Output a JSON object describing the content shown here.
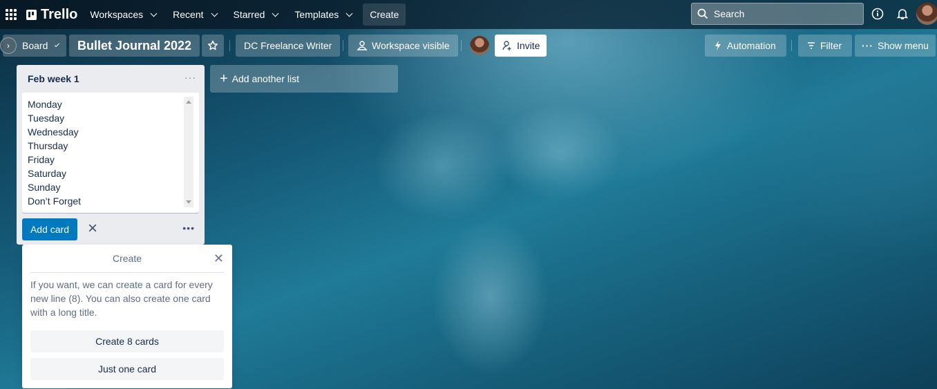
{
  "topbar": {
    "app_name": "Trello",
    "nav": [
      {
        "label": "Workspaces"
      },
      {
        "label": "Recent"
      },
      {
        "label": "Starred"
      },
      {
        "label": "Templates"
      }
    ],
    "create_label": "Create",
    "search_placeholder": "Search",
    "icons": [
      "apps-grid-icon",
      "info-icon",
      "bell-icon",
      "user-avatar"
    ]
  },
  "boardbar": {
    "view_label": "Board",
    "board_title": "Bullet Journal 2022",
    "workspace_label": "DC Freelance Writer",
    "visibility_label": "Workspace visible",
    "invite_label": "Invite",
    "automation_label": "Automation",
    "filter_label": "Filter",
    "show_menu_label": "Show menu"
  },
  "list": {
    "title": "Feb week 1",
    "composer_lines": [
      "Monday",
      "Tuesday",
      "Wednesday",
      "Thursday",
      "Friday",
      "Saturday",
      "Sunday",
      "Don’t Forget"
    ],
    "add_card_label": "Add card"
  },
  "add_list_label": "Add another list",
  "popover": {
    "title": "Create",
    "message": "If you want, we can create a card for every new line (8). You can also create one card with a long title.",
    "create_many_label": "Create 8 cards",
    "just_one_label": "Just one card"
  },
  "colors": {
    "primary_button": "#0079bf",
    "list_bg": "#ebecf0",
    "text_dark": "#172b4d"
  }
}
